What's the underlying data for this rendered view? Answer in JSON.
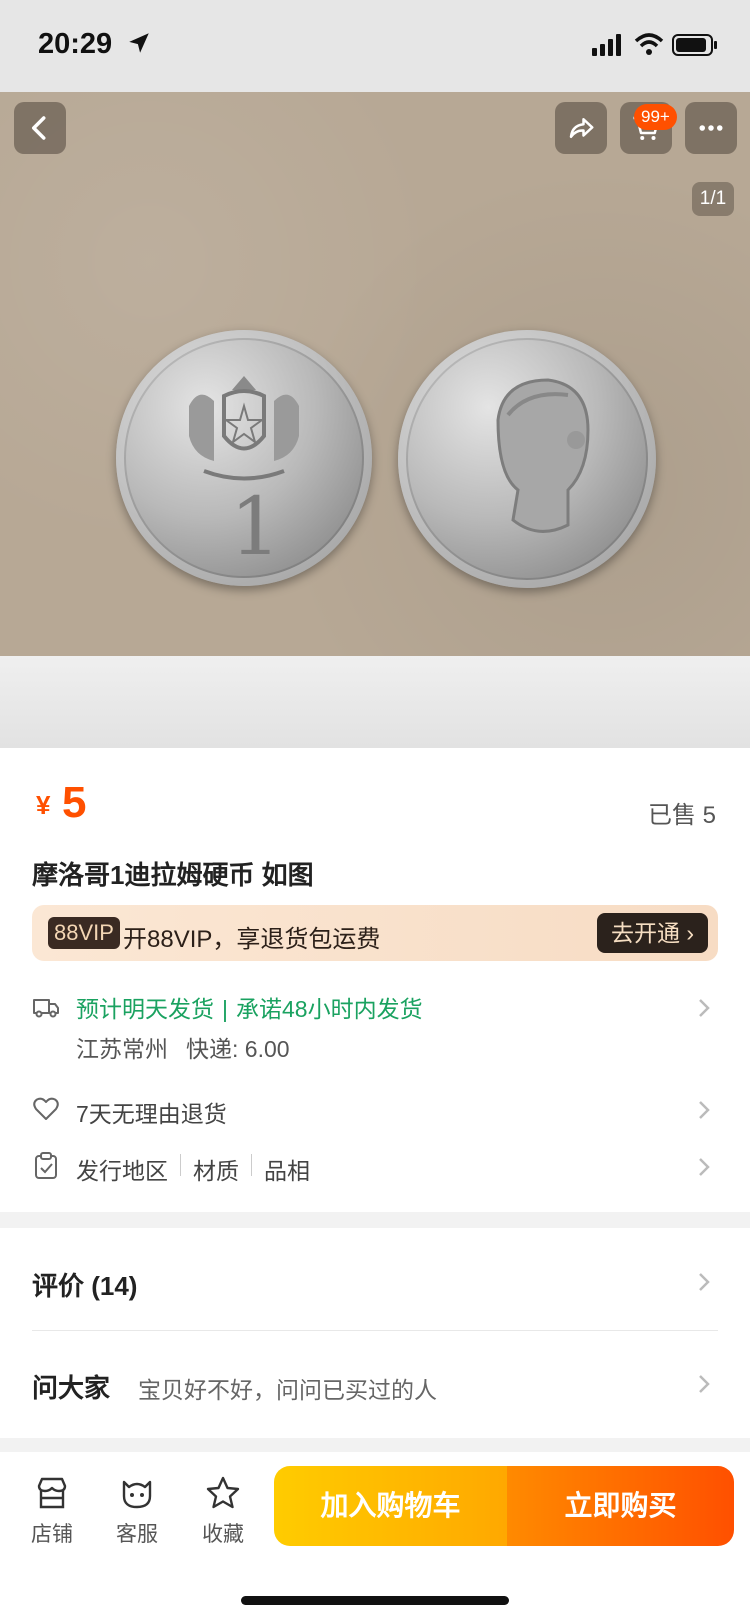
{
  "status_bar": {
    "time": "20:29"
  },
  "gallery": {
    "cart_badge": "99+",
    "page_indicator": "1/1",
    "coin_denomination": "1"
  },
  "product": {
    "currency": "¥",
    "price": "5",
    "sold": "已售 5",
    "title": "摩洛哥1迪拉姆硬币 如图"
  },
  "vip": {
    "tag": "88VIP",
    "text": "开88VIP，享退货包运费",
    "button": "去开通 ›"
  },
  "shipping": {
    "estimate": "预计明天发货",
    "promise": "承诺48小时内发货",
    "origin": "江苏常州",
    "fee": "快递: 6.00"
  },
  "returns": {
    "text": "7天无理由退货"
  },
  "params": {
    "items": [
      "发行地区",
      "材质",
      "品相"
    ]
  },
  "reviews": {
    "title": "评价 (14)"
  },
  "ask": {
    "title": "问大家",
    "hint": "宝贝好不好，问问已买过的人"
  },
  "bottom_bar": {
    "shop": "店铺",
    "service": "客服",
    "favorite": "收藏",
    "add_to_cart": "加入购物车",
    "buy_now": "立即购买"
  },
  "colors": {
    "accent": "#ff5000",
    "green": "#1aa260",
    "cart_btn": "#ffb800"
  }
}
